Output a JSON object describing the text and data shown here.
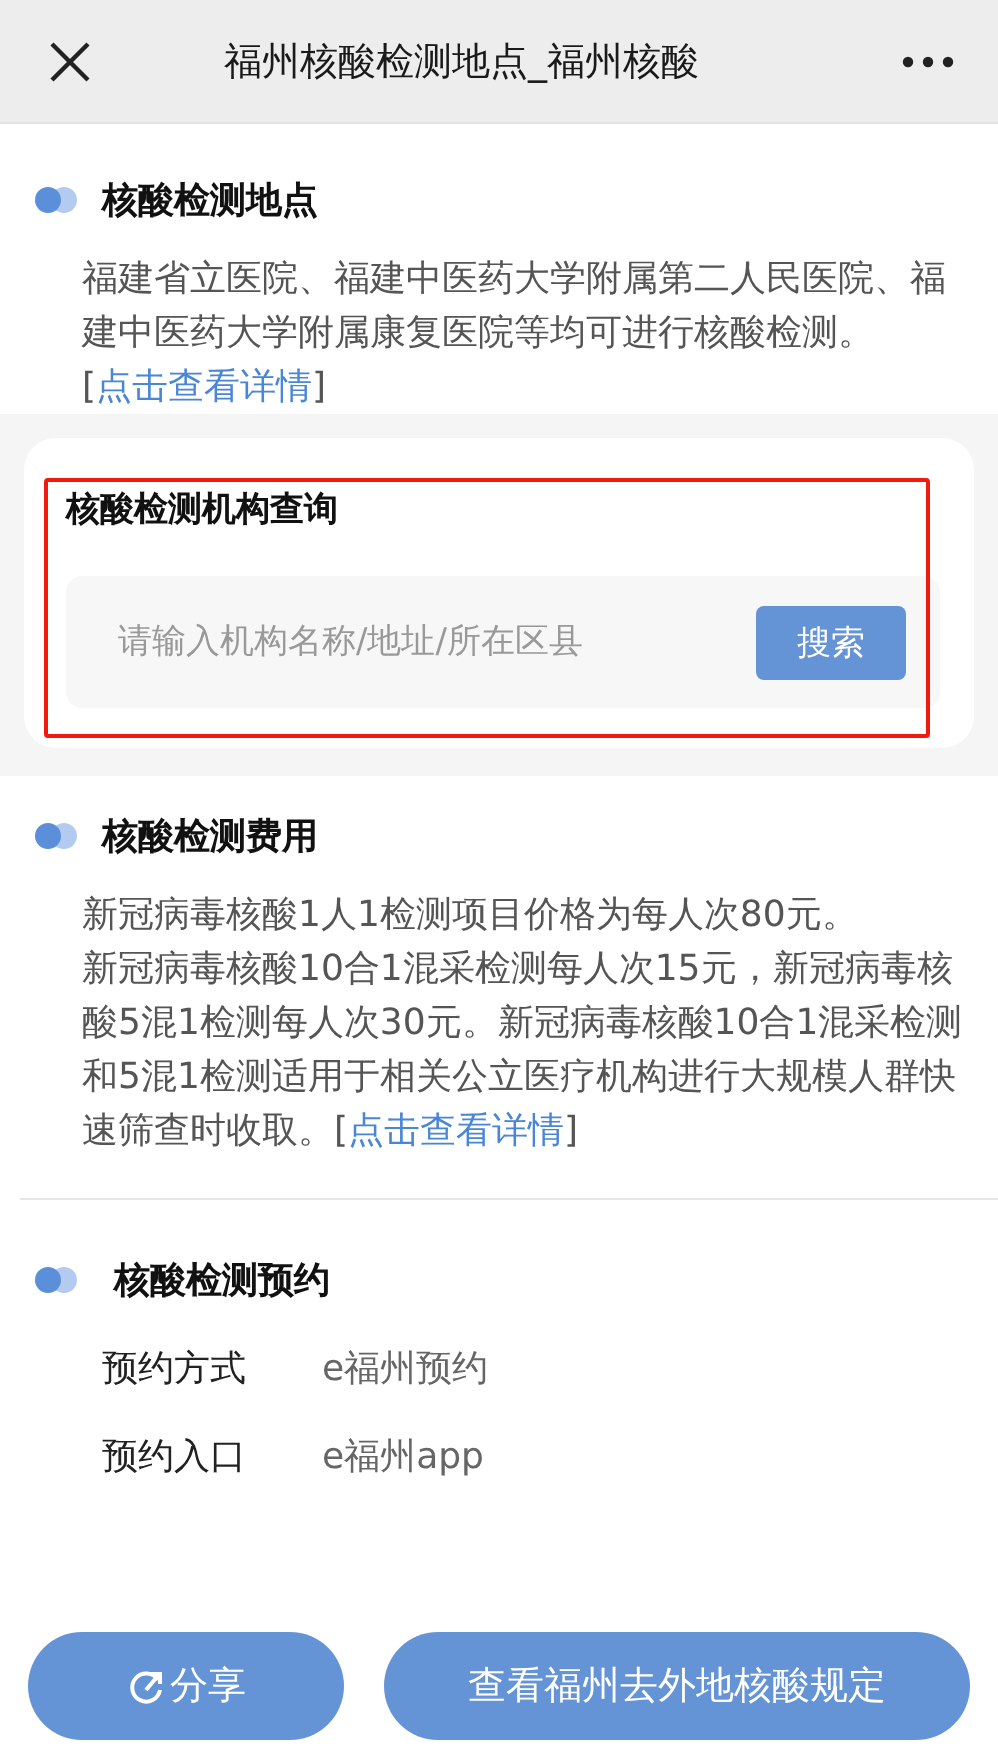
{
  "window": {
    "title": "福州核酸检测地点_福州核酸"
  },
  "sections": [
    {
      "kind": "text",
      "heading": "核酸检测地点",
      "paragraphs": [
        {
          "text": "福建省立医院、福建中医药大学附属第二人民医院、福建中医药大学附属康复医院等均可进行核酸检测。[",
          "link": "点击查看详情",
          "after": "]"
        }
      ]
    },
    {
      "kind": "search",
      "heading": "核酸检测机构查询",
      "placeholder": "请输入机构名称/地址/所在区县",
      "button": "搜索"
    },
    {
      "kind": "text",
      "heading": "核酸检测费用",
      "paragraphs": [
        {
          "text": "新冠病毒核酸1人1检测项目价格为每人次80元。"
        },
        {
          "text": "新冠病毒核酸10合1混采检测每人次15元，新冠病毒核酸5混1检测每人次30元。新冠病毒核酸10合1混采检测和5混1检测适用于相关公立医疗机构进行大规模人群快速筛查时收取。[",
          "link": "点击查看详情",
          "after": "]"
        }
      ]
    },
    {
      "kind": "pairs",
      "heading": "核酸检测预约",
      "rows": [
        {
          "label": "预约方式",
          "value": "e福州预约"
        },
        {
          "label": "预约入口",
          "value": "e福州app"
        }
      ]
    }
  ],
  "footer": {
    "share": "分享",
    "action": "查看福州去外地核酸规定"
  }
}
